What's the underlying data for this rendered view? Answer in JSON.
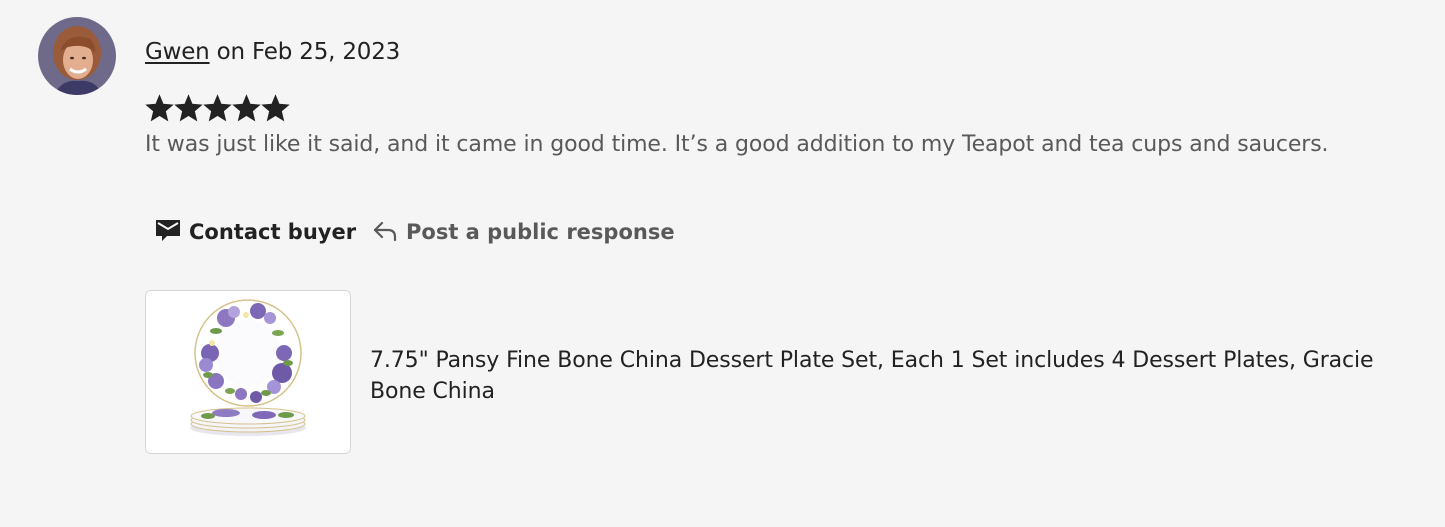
{
  "review": {
    "reviewer_name": "Gwen",
    "date_text": " on Feb 25, 2023",
    "rating": 5,
    "rating_max": 5,
    "text": "It was just like it said, and it came in good time. It’s a good addition to my Teapot and tea cups and saucers."
  },
  "actions": {
    "contact_label": "Contact buyer",
    "contact_icon": "envelope-icon",
    "post_label": "Post a public response",
    "post_icon": "reply-arrow-icon"
  },
  "product": {
    "title": "7.75\" Pansy Fine Bone China Dessert Plate Set, Each 1 Set includes 4 Dessert Plates, Gracie Bone China"
  },
  "colors": {
    "text_primary": "#222222",
    "text_secondary": "#595959",
    "background": "#f5f5f5",
    "star": "#222222"
  }
}
